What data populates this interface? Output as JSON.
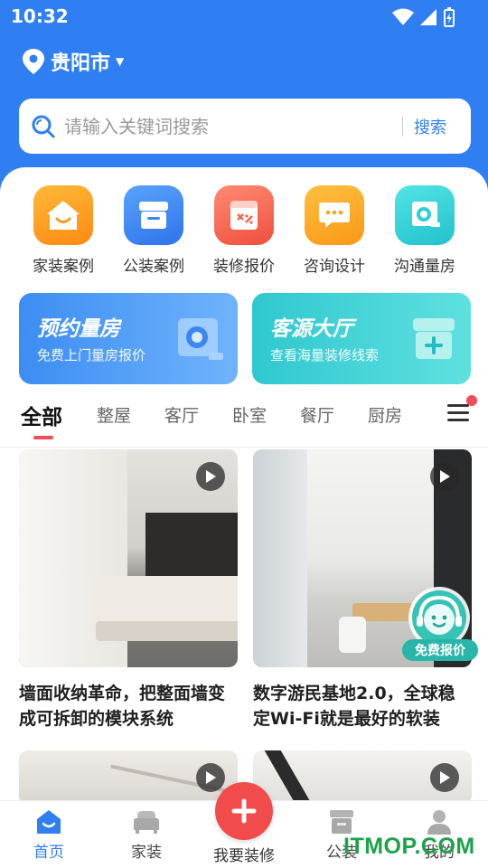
{
  "status_bar": {
    "time": "10:32"
  },
  "location": {
    "city": "贵阳市"
  },
  "search": {
    "placeholder": "请输入关键词搜索",
    "button_label": "搜索"
  },
  "categories": [
    {
      "label": "家装案例",
      "icon": "home-icon",
      "color": "#fb9b1d"
    },
    {
      "label": "公装案例",
      "icon": "storefront-icon",
      "color": "#3d86f2"
    },
    {
      "label": "装修报价",
      "icon": "calculator-icon",
      "color": "#f46450"
    },
    {
      "label": "咨询设计",
      "icon": "chat-bubble-icon",
      "color": "#fca41c"
    },
    {
      "label": "沟通量房",
      "icon": "tape-measure-icon",
      "color": "#2fcdd4"
    }
  ],
  "promos": [
    {
      "title": "预约量房",
      "subtitle": "免费上门量房报价",
      "icon": "tape-measure-icon"
    },
    {
      "title": "客源大厅",
      "subtitle": "查看海量装修线索",
      "icon": "store-icon"
    }
  ],
  "tabs": [
    {
      "label": "全部",
      "active": true
    },
    {
      "label": "整屋"
    },
    {
      "label": "客厅"
    },
    {
      "label": "卧室"
    },
    {
      "label": "餐厅"
    },
    {
      "label": "厨房"
    }
  ],
  "feed": [
    {
      "title": "墙面收纳革命，把整面墙变成可拆卸的模块系统",
      "has_video": true
    },
    {
      "title": "数字游民基地2.0，全球稳定Wi-Fi就是最好的软装",
      "has_video": true
    },
    {
      "title": "",
      "has_video": true
    },
    {
      "title": "",
      "has_video": true
    }
  ],
  "consult": {
    "label": "免费报价"
  },
  "bottom_nav": [
    {
      "label": "首页",
      "icon": "home-icon",
      "active": true
    },
    {
      "label": "家装",
      "icon": "sofa-icon"
    },
    {
      "label": "我要装修",
      "icon": "plus-icon"
    },
    {
      "label": "公装",
      "icon": "storefront-icon"
    },
    {
      "label": "我的",
      "icon": "user-icon"
    }
  ],
  "watermark": "ITMOP.COM",
  "colors": {
    "primary": "#2f7ff2",
    "accent_red": "#f24b4b",
    "indicator": "#f24b5a"
  }
}
